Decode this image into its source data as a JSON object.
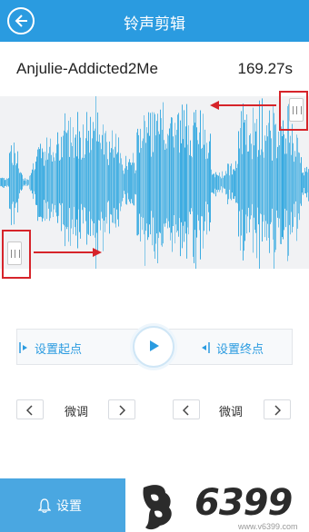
{
  "header": {
    "title": "铃声剪辑"
  },
  "track": {
    "name": "Anjulie-Addicted2Me",
    "duration": "169.27s"
  },
  "controls": {
    "set_start_label": "设置起点",
    "set_end_label": "设置终点",
    "fine_left_label": "微调",
    "fine_right_label": "微调"
  },
  "bottom": {
    "settings_label": "设置",
    "logo_text": "6399",
    "logo_url": "www.v6399.com"
  },
  "colors": {
    "accent": "#2a9be0",
    "wave": "#35a9e0",
    "marker": "#d6242a"
  },
  "icons": [
    "back-arrow-icon",
    "play-icon",
    "start-point-icon",
    "end-point-icon",
    "chevron-left-icon",
    "chevron-right-icon",
    "bell-icon"
  ]
}
